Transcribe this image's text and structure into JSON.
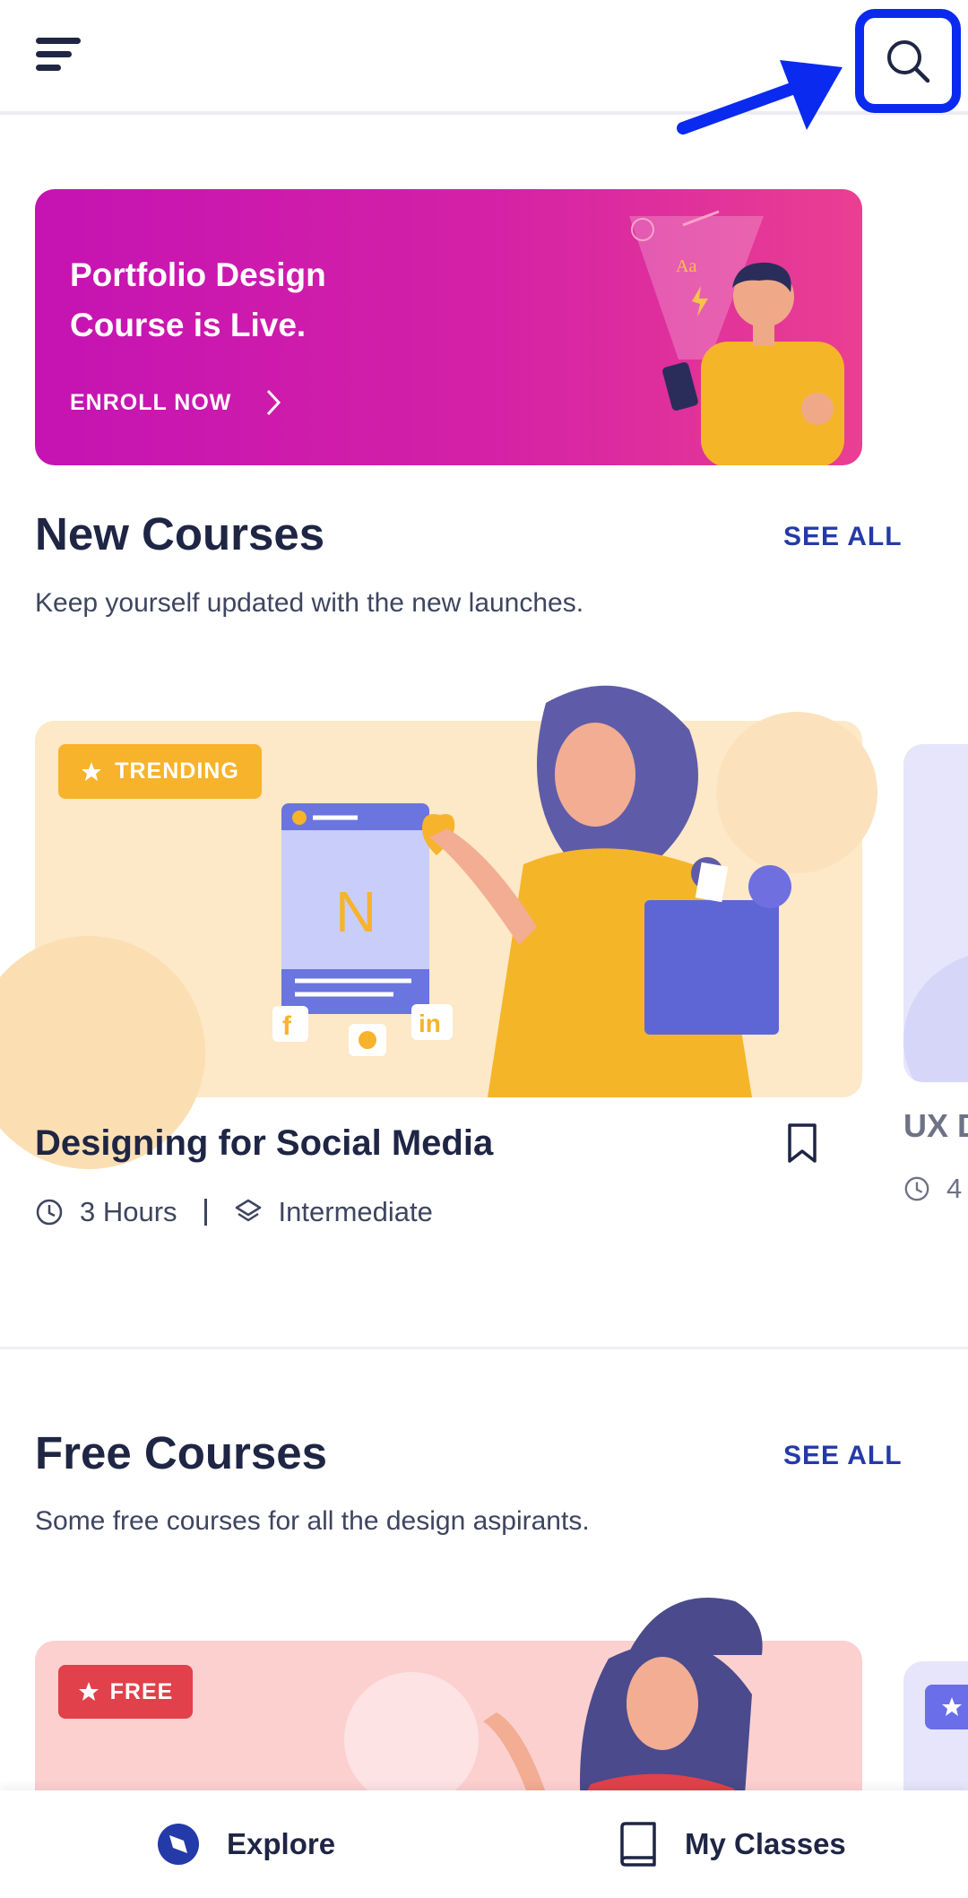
{
  "header": {
    "menu_icon": "hamburger-menu-icon",
    "search_icon": "search-icon"
  },
  "banner": {
    "title_line1": "Portfolio Design",
    "title_line2": "Course is Live.",
    "cta": "ENROLL NOW"
  },
  "new_courses": {
    "title": "New Courses",
    "see_all": "SEE ALL",
    "subtitle": "Keep yourself updated with the new launches.",
    "cards": [
      {
        "badge": "TRENDING",
        "title": "Designing for Social Media",
        "duration": "3 Hours",
        "level": "Intermediate"
      },
      {
        "title": "UX D",
        "duration": "4"
      }
    ]
  },
  "free_courses": {
    "title": "Free Courses",
    "see_all": "SEE ALL",
    "subtitle": "Some free courses for all the design aspirants.",
    "cards": [
      {
        "badge": "FREE"
      }
    ]
  },
  "bottom_nav": {
    "explore": "Explore",
    "my_classes": "My Classes"
  },
  "colors": {
    "accent_blue": "#243aa8",
    "annotation_blue": "#0a2aef",
    "trending_badge": "#f7b32b",
    "free_badge": "#e0414b",
    "text_dark": "#1f2544"
  }
}
